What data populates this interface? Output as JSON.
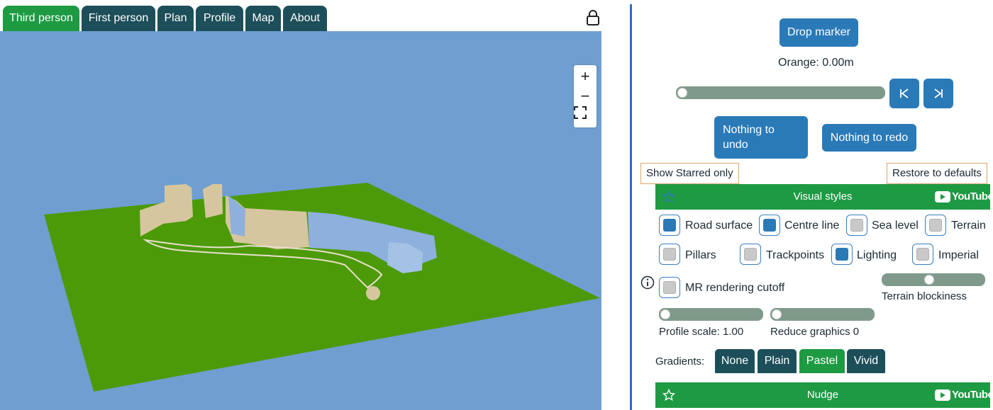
{
  "tabs": [
    {
      "label": "Third person",
      "active": true
    },
    {
      "label": "First person",
      "active": false
    },
    {
      "label": "Plan",
      "active": false
    },
    {
      "label": "Profile",
      "active": false
    },
    {
      "label": "Map",
      "active": false
    },
    {
      "label": "About",
      "active": false
    }
  ],
  "view": {
    "zoom_in": "+",
    "zoom_out": "−",
    "fullscreen_icon": "fullscreen-icon",
    "colors": {
      "sky": "#6f9fd1",
      "ground": "#4c9a08",
      "terrain": "#d6c6a0",
      "water": "#8db0dc"
    }
  },
  "controls": {
    "drop_marker": "Drop marker",
    "orange_readout": "Orange: 0.00m",
    "marker_slider_value": 0,
    "prev_icon": "skip-back-icon",
    "next_icon": "skip-forward-icon",
    "undo": "Nothing to undo",
    "redo": "Nothing to redo",
    "show_starred": "Show Starred only",
    "restore_defaults": "Restore to defaults"
  },
  "visual_styles": {
    "title": "Visual styles",
    "youtube": "YouTube",
    "options": [
      {
        "label": "Road surface",
        "checked": true
      },
      {
        "label": "Centre line",
        "checked": true
      },
      {
        "label": "Sea level",
        "checked": false
      },
      {
        "label": "Terrain",
        "checked": false
      },
      {
        "label": "Pillars",
        "checked": false
      },
      {
        "label": "Trackpoints",
        "checked": false
      },
      {
        "label": "Lighting",
        "checked": true
      },
      {
        "label": "Imperial",
        "checked": false
      },
      {
        "label": "MR rendering cutoff",
        "checked": false
      }
    ],
    "terrain_blockiness_label": "Terrain blockiness",
    "terrain_blockiness_value": 0.45,
    "profile_scale_label": "Profile scale: 1.00",
    "profile_scale_value": 0,
    "reduce_graphics_label": "Reduce graphics 0",
    "reduce_graphics_value": 0,
    "gradients_label": "Gradients:",
    "gradients": [
      {
        "label": "None",
        "active": false
      },
      {
        "label": "Plain",
        "active": false
      },
      {
        "label": "Pastel",
        "active": true
      },
      {
        "label": "Vivid",
        "active": false
      }
    ]
  },
  "nudge": {
    "title": "Nudge",
    "youtube": "YouTube"
  }
}
